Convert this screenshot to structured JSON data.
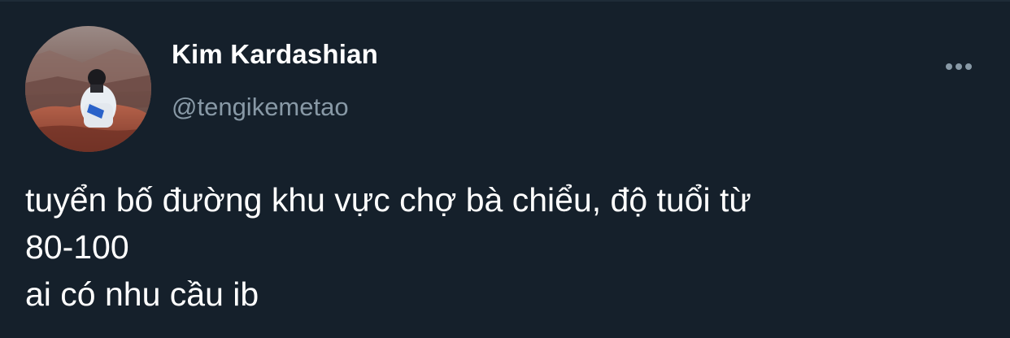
{
  "author": {
    "display_name": "Kim Kardashian",
    "handle": "@tengikemetao",
    "avatar_icon": "profile-photo"
  },
  "tweet": {
    "lines": [
      "tuyển bố đường khu vực chợ bà chiểu, độ tuổi từ",
      "80-100",
      "ai có nhu cầu ib"
    ]
  },
  "actions": {
    "more_icon": "more-horizontal-icon"
  },
  "colors": {
    "background": "#15202b",
    "primary_text": "#ffffff",
    "secondary_text": "#8899a6"
  }
}
